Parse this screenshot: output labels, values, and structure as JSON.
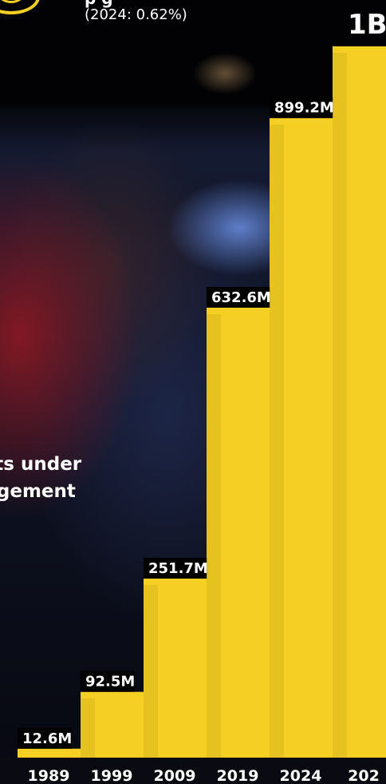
{
  "header": {
    "title_fragment": "p g",
    "subtitle": "(2024: 0.62%)"
  },
  "aum_label": {
    "line1": "sets under",
    "line2": "nagement"
  },
  "colors": {
    "bar": "#f5cf24",
    "bar_label_bg": "#000000",
    "bar_label_text": "#ffffff",
    "badge": "#f5cf24"
  },
  "badge_icon": "circled-down-arrow-icon",
  "chart_data": {
    "type": "bar",
    "categories": [
      "1989",
      "1999",
      "2009",
      "2019",
      "2024",
      "202"
    ],
    "values": [
      12.6,
      92.5,
      251.7,
      632.6,
      899.2,
      1000
    ],
    "labels": [
      "12.6M",
      "92.5M",
      "251.7M",
      "632.6M",
      "899.2M",
      "1B"
    ],
    "title": "",
    "xlabel": "",
    "ylabel": "",
    "ylim": [
      0,
      1000
    ],
    "grid": false
  }
}
